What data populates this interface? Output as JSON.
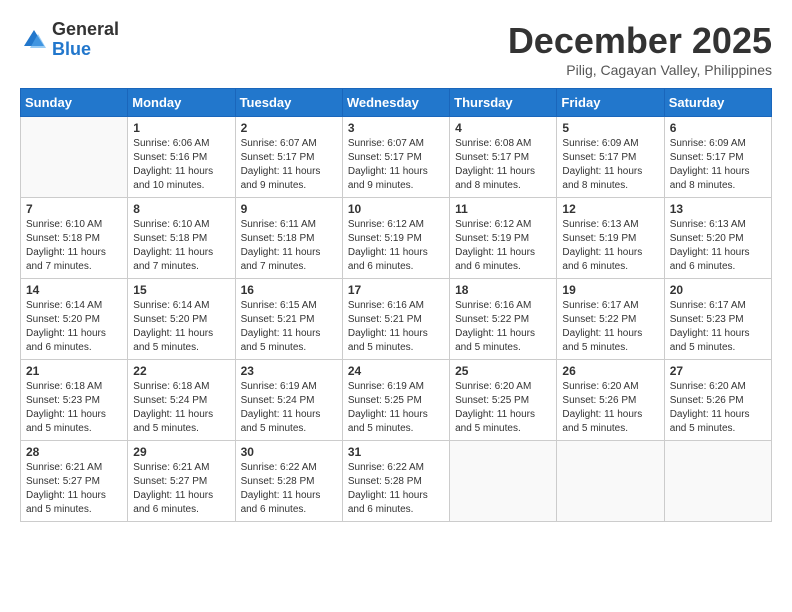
{
  "logo": {
    "general": "General",
    "blue": "Blue"
  },
  "title": "December 2025",
  "location": "Pilig, Cagayan Valley, Philippines",
  "days_of_week": [
    "Sunday",
    "Monday",
    "Tuesday",
    "Wednesday",
    "Thursday",
    "Friday",
    "Saturday"
  ],
  "weeks": [
    [
      {
        "day": "",
        "sunrise": "",
        "sunset": "",
        "daylight": ""
      },
      {
        "day": "1",
        "sunrise": "6:06 AM",
        "sunset": "5:16 PM",
        "daylight": "11 hours and 10 minutes."
      },
      {
        "day": "2",
        "sunrise": "6:07 AM",
        "sunset": "5:17 PM",
        "daylight": "11 hours and 9 minutes."
      },
      {
        "day": "3",
        "sunrise": "6:07 AM",
        "sunset": "5:17 PM",
        "daylight": "11 hours and 9 minutes."
      },
      {
        "day": "4",
        "sunrise": "6:08 AM",
        "sunset": "5:17 PM",
        "daylight": "11 hours and 8 minutes."
      },
      {
        "day": "5",
        "sunrise": "6:09 AM",
        "sunset": "5:17 PM",
        "daylight": "11 hours and 8 minutes."
      },
      {
        "day": "6",
        "sunrise": "6:09 AM",
        "sunset": "5:17 PM",
        "daylight": "11 hours and 8 minutes."
      }
    ],
    [
      {
        "day": "7",
        "sunrise": "6:10 AM",
        "sunset": "5:18 PM",
        "daylight": "11 hours and 7 minutes."
      },
      {
        "day": "8",
        "sunrise": "6:10 AM",
        "sunset": "5:18 PM",
        "daylight": "11 hours and 7 minutes."
      },
      {
        "day": "9",
        "sunrise": "6:11 AM",
        "sunset": "5:18 PM",
        "daylight": "11 hours and 7 minutes."
      },
      {
        "day": "10",
        "sunrise": "6:12 AM",
        "sunset": "5:19 PM",
        "daylight": "11 hours and 6 minutes."
      },
      {
        "day": "11",
        "sunrise": "6:12 AM",
        "sunset": "5:19 PM",
        "daylight": "11 hours and 6 minutes."
      },
      {
        "day": "12",
        "sunrise": "6:13 AM",
        "sunset": "5:19 PM",
        "daylight": "11 hours and 6 minutes."
      },
      {
        "day": "13",
        "sunrise": "6:13 AM",
        "sunset": "5:20 PM",
        "daylight": "11 hours and 6 minutes."
      }
    ],
    [
      {
        "day": "14",
        "sunrise": "6:14 AM",
        "sunset": "5:20 PM",
        "daylight": "11 hours and 6 minutes."
      },
      {
        "day": "15",
        "sunrise": "6:14 AM",
        "sunset": "5:20 PM",
        "daylight": "11 hours and 5 minutes."
      },
      {
        "day": "16",
        "sunrise": "6:15 AM",
        "sunset": "5:21 PM",
        "daylight": "11 hours and 5 minutes."
      },
      {
        "day": "17",
        "sunrise": "6:16 AM",
        "sunset": "5:21 PM",
        "daylight": "11 hours and 5 minutes."
      },
      {
        "day": "18",
        "sunrise": "6:16 AM",
        "sunset": "5:22 PM",
        "daylight": "11 hours and 5 minutes."
      },
      {
        "day": "19",
        "sunrise": "6:17 AM",
        "sunset": "5:22 PM",
        "daylight": "11 hours and 5 minutes."
      },
      {
        "day": "20",
        "sunrise": "6:17 AM",
        "sunset": "5:23 PM",
        "daylight": "11 hours and 5 minutes."
      }
    ],
    [
      {
        "day": "21",
        "sunrise": "6:18 AM",
        "sunset": "5:23 PM",
        "daylight": "11 hours and 5 minutes."
      },
      {
        "day": "22",
        "sunrise": "6:18 AM",
        "sunset": "5:24 PM",
        "daylight": "11 hours and 5 minutes."
      },
      {
        "day": "23",
        "sunrise": "6:19 AM",
        "sunset": "5:24 PM",
        "daylight": "11 hours and 5 minutes."
      },
      {
        "day": "24",
        "sunrise": "6:19 AM",
        "sunset": "5:25 PM",
        "daylight": "11 hours and 5 minutes."
      },
      {
        "day": "25",
        "sunrise": "6:20 AM",
        "sunset": "5:25 PM",
        "daylight": "11 hours and 5 minutes."
      },
      {
        "day": "26",
        "sunrise": "6:20 AM",
        "sunset": "5:26 PM",
        "daylight": "11 hours and 5 minutes."
      },
      {
        "day": "27",
        "sunrise": "6:20 AM",
        "sunset": "5:26 PM",
        "daylight": "11 hours and 5 minutes."
      }
    ],
    [
      {
        "day": "28",
        "sunrise": "6:21 AM",
        "sunset": "5:27 PM",
        "daylight": "11 hours and 5 minutes."
      },
      {
        "day": "29",
        "sunrise": "6:21 AM",
        "sunset": "5:27 PM",
        "daylight": "11 hours and 6 minutes."
      },
      {
        "day": "30",
        "sunrise": "6:22 AM",
        "sunset": "5:28 PM",
        "daylight": "11 hours and 6 minutes."
      },
      {
        "day": "31",
        "sunrise": "6:22 AM",
        "sunset": "5:28 PM",
        "daylight": "11 hours and 6 minutes."
      },
      {
        "day": "",
        "sunrise": "",
        "sunset": "",
        "daylight": ""
      },
      {
        "day": "",
        "sunrise": "",
        "sunset": "",
        "daylight": ""
      },
      {
        "day": "",
        "sunrise": "",
        "sunset": "",
        "daylight": ""
      }
    ]
  ],
  "labels": {
    "sunrise": "Sunrise:",
    "sunset": "Sunset:",
    "daylight": "Daylight:"
  }
}
